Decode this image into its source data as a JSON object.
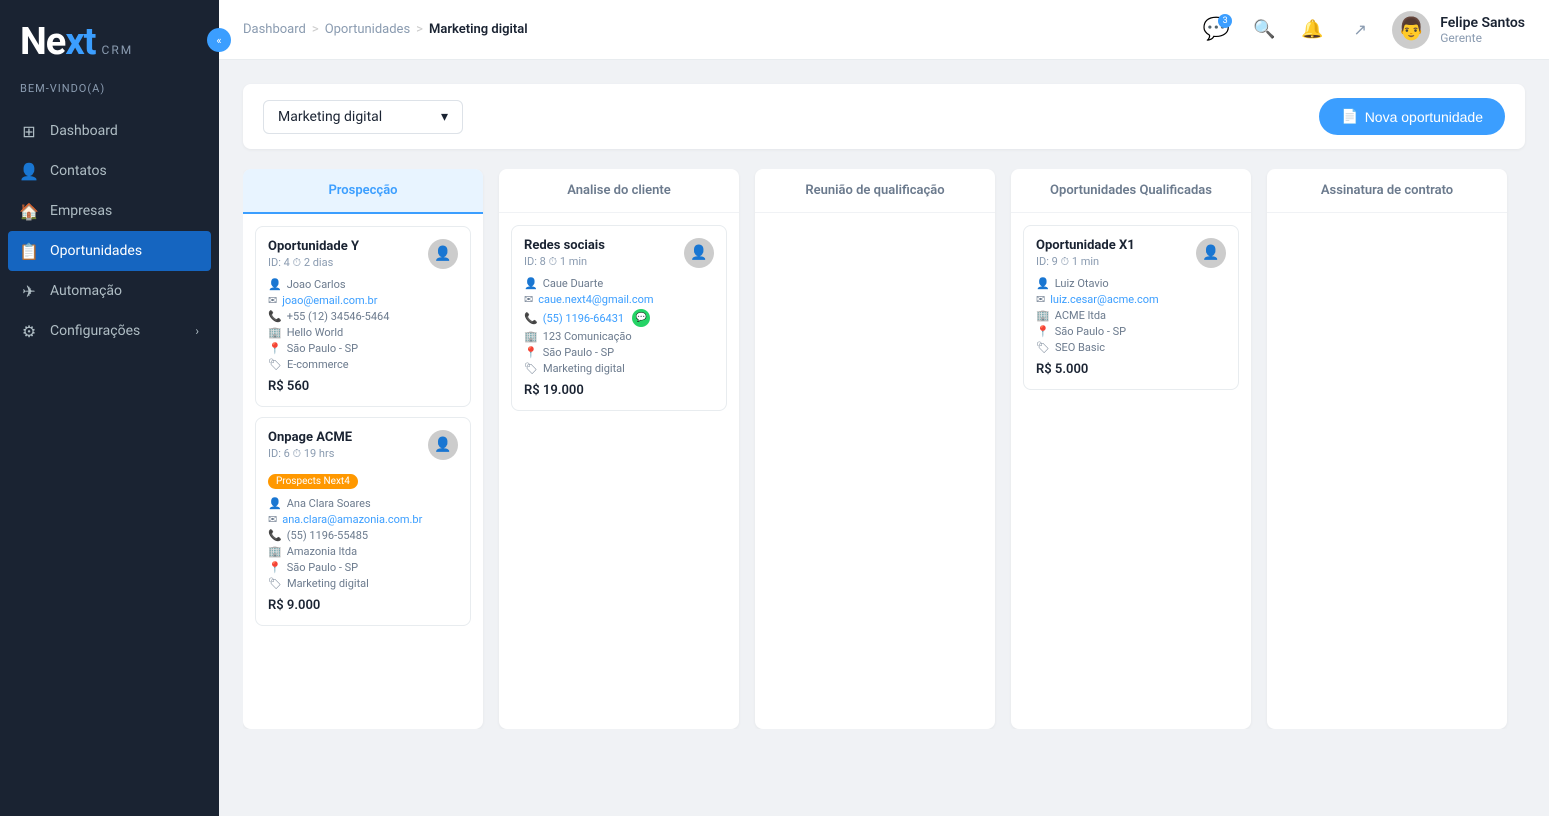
{
  "app": {
    "logo_next": "Ne",
    "logo_xt": "xt",
    "logo_crm": "CRM",
    "welcome": "BEM-VINDO(A)"
  },
  "sidebar": {
    "toggle_icon": "«",
    "items": [
      {
        "id": "dashboard",
        "label": "Dashboard",
        "icon": "⊞",
        "active": false
      },
      {
        "id": "contatos",
        "label": "Contatos",
        "icon": "👤",
        "active": false
      },
      {
        "id": "empresas",
        "label": "Empresas",
        "icon": "🏠",
        "active": false
      },
      {
        "id": "oportunidades",
        "label": "Oportunidades",
        "icon": "📋",
        "active": true
      },
      {
        "id": "automacao",
        "label": "Automação",
        "icon": "✈",
        "active": false
      },
      {
        "id": "configuracoes",
        "label": "Configurações",
        "icon": "⚙",
        "active": false,
        "has_chevron": true
      }
    ]
  },
  "header": {
    "breadcrumb": {
      "dashboard": "Dashboard",
      "separator1": ">",
      "oportunidades": "Oportunidades",
      "separator2": ">",
      "current": "Marketing digital"
    },
    "icons": {
      "whatsapp_badge": "3",
      "whatsapp_label": "WhatsApp",
      "search_label": "Pesquisar",
      "bell_label": "Notificações",
      "share_label": "Compartilhar"
    },
    "user": {
      "name": "Felipe Santos",
      "role": "Gerente",
      "avatar_text": "👤"
    }
  },
  "toolbar": {
    "dropdown_label": "Marketing digital",
    "new_button": "Nova oportunidade"
  },
  "columns": [
    {
      "id": "prospeccao",
      "label": "Prospecção",
      "active": true
    },
    {
      "id": "analise",
      "label": "Analise do cliente",
      "active": false
    },
    {
      "id": "reuniao",
      "label": "Reunião de qualificação",
      "active": false
    },
    {
      "id": "qualificadas",
      "label": "Oportunidades Qualificadas",
      "active": false
    },
    {
      "id": "assinatura",
      "label": "Assinatura de contrato",
      "active": false
    }
  ],
  "cards": {
    "prospeccao": [
      {
        "id": "card-oportunidade-y",
        "title": "Oportunidade Y",
        "meta": "ID: 4  ⏱ 2 dias",
        "contact": "Joao Carlos",
        "email": "joao@email.com.br",
        "phone": "+55 (12) 34546-5464",
        "company": "Hello World",
        "location": "São Paulo - SP",
        "tag_label": "E-commerce",
        "price": "R$ 560",
        "has_tag": false
      },
      {
        "id": "card-onpage-acme",
        "title": "Onpage ACME",
        "meta": "ID: 6  ⏱ 19 hrs",
        "contact": "Ana Clara Soares",
        "email": "ana.clara@amazonia.com.br",
        "phone": "(55) 1196-55485",
        "company": "Amazonia ltda",
        "location": "São Paulo - SP",
        "tag_label": "Marketing digital",
        "price": "R$ 9.000",
        "has_tag": true,
        "tag_text": "Prospects Next4"
      }
    ],
    "analise": [
      {
        "id": "card-redes-sociais",
        "title": "Redes sociais",
        "meta": "ID: 8  ⏱ 1 min",
        "contact": "Caue Duarte",
        "email": "caue.next4@gmail.com",
        "phone": "(55) 1196-66431",
        "phone_has_whatsapp": true,
        "company": "123 Comunicação",
        "location": "São Paulo - SP",
        "tag_label": "Marketing digital",
        "price": "R$ 19.000",
        "has_tag": false
      }
    ],
    "reuniao": [],
    "qualificadas": [
      {
        "id": "card-oportunidade-x1",
        "title": "Oportunidade X1",
        "meta": "ID: 9  ⏱ 1 min",
        "contact": "Luiz Otavio",
        "email": "luiz.cesar@acme.com",
        "phone": null,
        "company": "ACME ltda",
        "location": "São Paulo - SP",
        "tag_label": "SEO Basic",
        "price": "R$ 5.000",
        "has_tag": false
      }
    ],
    "assinatura": []
  }
}
